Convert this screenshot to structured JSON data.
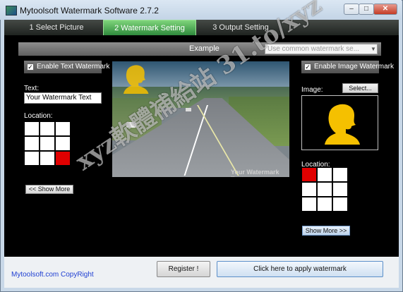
{
  "window": {
    "title": "Mytoolsoft Watermark Software 2.7.2"
  },
  "tabs": [
    {
      "label": "1 Select Picture"
    },
    {
      "label": "2 Watermark Setting"
    },
    {
      "label": "3 Output Setting"
    }
  ],
  "example": {
    "label": "Example",
    "select_value": "Use common watermark se..."
  },
  "text_watermark": {
    "enable_label": "Enable Text Watermark",
    "enabled": true,
    "text_label": "Text:",
    "text_value": "Your Watermark Text",
    "location_label": "Location:",
    "selected_cell": 9,
    "show_more_label": "<< Show More"
  },
  "preview": {
    "watermark_text": "Your Watermark Text"
  },
  "image_watermark": {
    "enable_label": "Enable Image Watermark",
    "enabled": true,
    "image_label": "Image:",
    "select_label": "Select...",
    "location_label": "Location:",
    "selected_cell": 1,
    "show_more_label": "Show More >>"
  },
  "footer": {
    "copyright": "Mytoolsoft.com CopyRight",
    "register_label": "Register !",
    "apply_label": "Click here to apply watermark"
  },
  "overlay_watermark": "xyz軟體補給站 31.to/xyz",
  "colors": {
    "accent_tab": "#2f8a3d",
    "selected_cell": "#e00000",
    "silhouette": "#f5c000",
    "link": "#1f3fd2"
  }
}
